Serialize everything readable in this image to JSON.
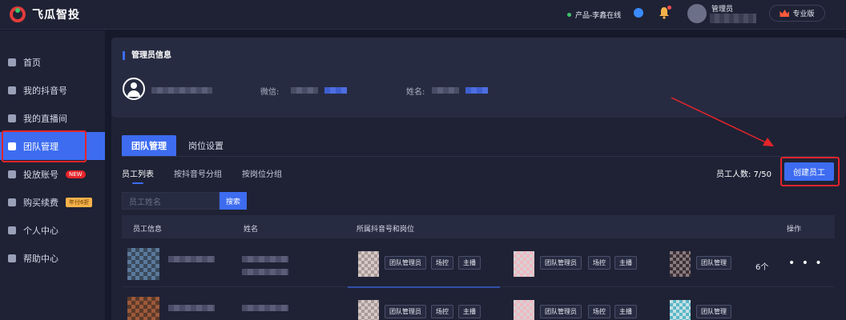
{
  "app": {
    "brand": "飞瓜智投"
  },
  "topbar": {
    "status": "产品-李鑫在线",
    "user_name": "管理员",
    "plan": "专业版"
  },
  "sidebar": {
    "items": [
      {
        "label": "首页"
      },
      {
        "label": "我的抖音号"
      },
      {
        "label": "我的直播间"
      },
      {
        "label": "团队管理",
        "active": true
      },
      {
        "label": "投放账号",
        "badge": "NEW"
      },
      {
        "label": "购买续费",
        "badge": "年付6折"
      },
      {
        "label": "个人中心"
      },
      {
        "label": "帮助中心"
      }
    ]
  },
  "admin": {
    "section_title": "管理员信息",
    "wechat_label": "微信:",
    "name_label": "姓名:"
  },
  "team": {
    "tabs": [
      "团队管理",
      "岗位设置"
    ],
    "sub_tabs": [
      "员工列表",
      "按抖音号分组",
      "按岗位分组"
    ],
    "staff_count": "员工人数: 7/50",
    "create_button": "创建员工",
    "search_placeholder": "员工姓名",
    "search_button": "搜索",
    "columns": [
      "员工信息",
      "姓名",
      "所属抖音号和岗位",
      "操作"
    ]
  },
  "rows": [
    {
      "groups": [
        {
          "tags": [
            "团队管理员",
            "场控",
            "主播"
          ]
        },
        {
          "tags": [
            "团队管理员",
            "场控",
            "主播"
          ]
        },
        {
          "tags": [
            "团队管理"
          ]
        }
      ],
      "count": "6个",
      "actions": "• • •"
    },
    {
      "groups": [
        {
          "tags": [
            "团队管理员",
            "场控",
            "主播"
          ]
        },
        {
          "tags": [
            "团队管理员",
            "场控",
            "主播"
          ]
        },
        {
          "tags": [
            "团队管理"
          ]
        }
      ]
    }
  ],
  "colors": {
    "accent": "#3d6cf1",
    "highlight": "#e5242a",
    "bg": "#16192a",
    "panel": "#1f2235"
  }
}
